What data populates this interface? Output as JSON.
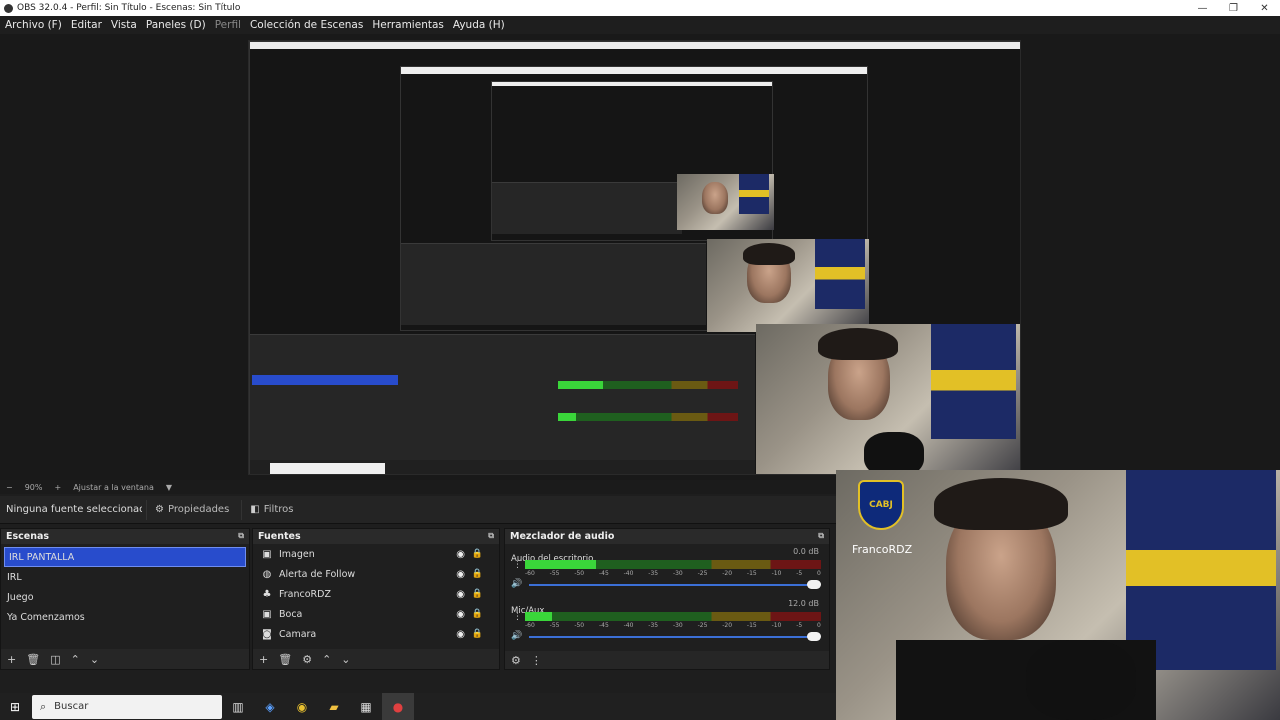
{
  "window": {
    "title": "OBS 32.0.4 - Perfil: Sin Título - Escenas: Sin Título",
    "minimize": "—",
    "restore": "❐",
    "close": "✕"
  },
  "menu": [
    {
      "label": "Archivo (F)",
      "dim": false
    },
    {
      "label": "Editar",
      "dim": false
    },
    {
      "label": "Vista",
      "dim": false
    },
    {
      "label": "Paneles (D)",
      "dim": false
    },
    {
      "label": "Perfil",
      "dim": true
    },
    {
      "label": "Colección de Escenas",
      "dim": false
    },
    {
      "label": "Herramientas",
      "dim": false
    },
    {
      "label": "Ayuda (H)",
      "dim": false
    }
  ],
  "zoombar": {
    "minus": "−",
    "zoom": "90%",
    "plus": "+",
    "fit": "Ajustar a la ventana",
    "arrow": "▼"
  },
  "properties": {
    "no_source": "Ninguna fuente seleccionada",
    "properties_btn": "Propiedades",
    "filters_btn": "Filtros"
  },
  "scenes": {
    "title": "Escenas",
    "items": [
      "IRL PANTALLA",
      "IRL",
      "Juego",
      "Ya Comenzamos"
    ],
    "selected": 0
  },
  "sources": {
    "title": "Fuentes",
    "items": [
      {
        "label": "Imagen",
        "icon": "image-icon"
      },
      {
        "label": "Alerta de Follow",
        "icon": "browser-icon"
      },
      {
        "label": "FrancoRDZ",
        "icon": "text-icon"
      },
      {
        "label": "Boca",
        "icon": "image-icon"
      },
      {
        "label": "Camara",
        "icon": "camera-icon"
      }
    ]
  },
  "audio": {
    "title": "Mezclador de audio",
    "tracks": [
      {
        "name": "Audio del escritorio",
        "db": "0.0 dB",
        "level": 0.24
      },
      {
        "name": "Mic/Aux",
        "db": "12.0 dB",
        "level": 0.09
      }
    ],
    "scale": [
      "-60",
      "-55",
      "-50",
      "-45",
      "-40",
      "-35",
      "-30",
      "-25",
      "-20",
      "-15",
      "-10",
      "-5",
      "0"
    ]
  },
  "webcam": {
    "overlay_name": "FrancoRDZ",
    "badge_text": "CABJ"
  },
  "taskbar": {
    "search_placeholder": "Buscar"
  },
  "colors": {
    "accent": "#284ccc",
    "meter_green": "#3ad63a",
    "brand_blue": "#0e2a7a",
    "brand_gold": "#e2c026"
  }
}
